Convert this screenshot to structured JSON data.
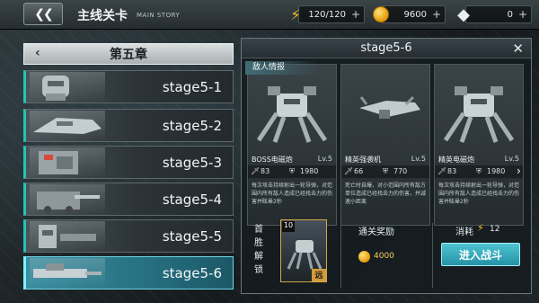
{
  "header": {
    "back_label": "❮❮",
    "title": "主线关卡",
    "subtitle": "MAIN STORY",
    "energy": {
      "icon": "lightning-icon",
      "value": "120/120"
    },
    "gold": {
      "icon": "coin-icon",
      "value": "9600"
    },
    "gems": {
      "icon": "diamond-icon",
      "value": "0"
    },
    "plus": "+"
  },
  "chapter": {
    "title": "第五章",
    "prev_icon": "chevron-left-icon"
  },
  "stages": [
    {
      "label": "stage5-1"
    },
    {
      "label": "stage5-2"
    },
    {
      "label": "stage5-3"
    },
    {
      "label": "stage5-4"
    },
    {
      "label": "stage5-5"
    },
    {
      "label": "stage5-6"
    }
  ],
  "selected_stage": "stage5-6",
  "panel": {
    "title": "stage5-6",
    "close_icon": "close-icon",
    "intel_label": "敌人情报",
    "enemies": [
      {
        "name": "BOSS电磁炮",
        "level": "Lv.5",
        "atk": "83",
        "hp": "1980",
        "desc": "每次攻击持续射出一轮导弹，对范围内所有敌人造成已经找击力的伤害并眩晕2秒"
      },
      {
        "name": "精英强袭机",
        "level": "Lv.5",
        "atk": "66",
        "hp": "770",
        "desc": "死亡时自爆，对小范围内所有敌方单位造成已经找击力的伤害，并减速小距离"
      },
      {
        "name": "精英电磁炮",
        "level": "Lv.5",
        "atk": "83",
        "hp": "1980",
        "desc": "每次攻击持续射出一轮导弹，对范围内所有敌人造成已经找击力的伤害并眩晕2秒"
      }
    ],
    "first_clear_label": "首胜解锁",
    "reward_card": {
      "number": "10",
      "tag": "远"
    },
    "clear_reward_label": "通关奖励",
    "clear_reward_gold": "4000",
    "cost_label": "消耗",
    "cost_value": "12",
    "battle_button": "进入战斗"
  },
  "colors": {
    "accent": "#24c3b5",
    "active_stage": "#2b8596",
    "gold": "#f4cf5e",
    "energy": "#f5c21b"
  }
}
